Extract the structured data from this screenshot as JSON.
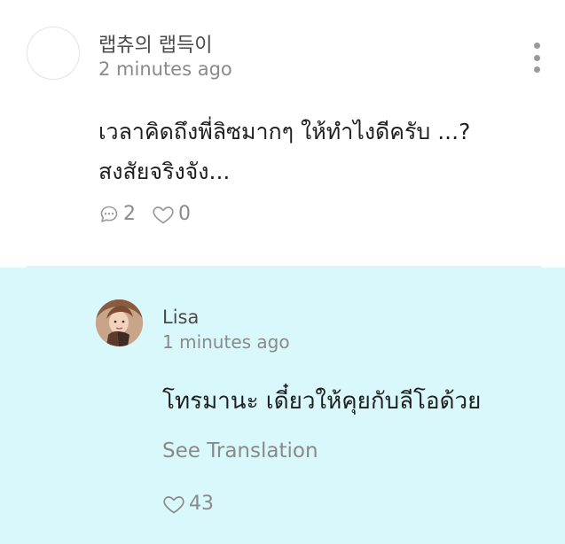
{
  "post": {
    "author": "랩츄의 랩득이",
    "time": "2 minutes ago",
    "body_line1": "เวลาคิดถึงพี่ลิซมากๆ ให้ทำไงดีครับ ...?",
    "body_line2": "สงสัยจริงจัง...",
    "comments_count": "2",
    "likes_count": "0"
  },
  "reply": {
    "author": "Lisa",
    "time": "1 minutes ago",
    "body": "โทรมานะ เดี๋ยวให้คุยกับลีโอด้วย",
    "translate_label": "See Translation",
    "likes_count": "43"
  },
  "colors": {
    "reply_background": "#d9f8fb",
    "muted_text": "#8a8a8a",
    "icon_gray": "#9a9a9a"
  },
  "icons": [
    "more-vertical-icon",
    "comment-bubble-icon",
    "heart-outline-icon"
  ]
}
